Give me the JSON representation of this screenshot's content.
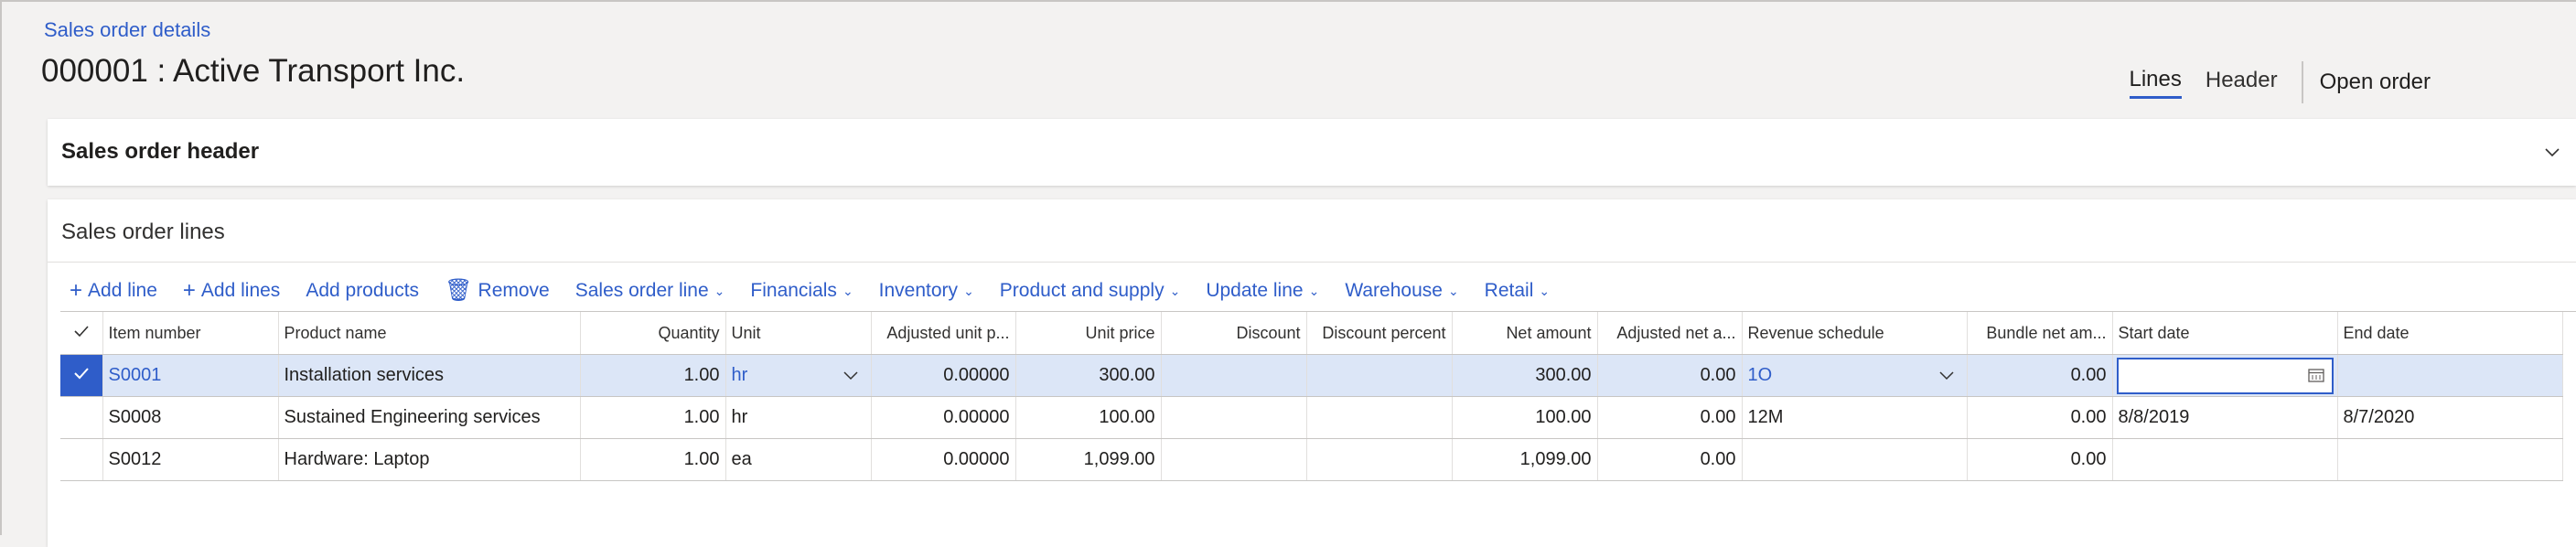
{
  "breadcrumb": "Sales order details",
  "page_title": "000001 : Active Transport Inc.",
  "tabs": {
    "lines": "Lines",
    "header": "Header",
    "open_order": "Open order"
  },
  "header_section": {
    "title": "Sales order header"
  },
  "lines_section": {
    "title": "Sales order lines"
  },
  "toolbar": {
    "add_line": "Add line",
    "add_lines": "Add lines",
    "add_products": "Add products",
    "remove": "Remove",
    "sales_order_line": "Sales order line",
    "financials": "Financials",
    "inventory": "Inventory",
    "product_and_supply": "Product and supply",
    "update_line": "Update line",
    "warehouse": "Warehouse",
    "retail": "Retail"
  },
  "grid": {
    "columns": [
      "Item number",
      "Product name",
      "Quantity",
      "Unit",
      "Adjusted unit p...",
      "Unit price",
      "Discount",
      "Discount percent",
      "Net amount",
      "Adjusted net a...",
      "Revenue schedule",
      "Bundle net am...",
      "Start date",
      "End date"
    ],
    "rows": [
      {
        "item": "S0001",
        "product": "Installation services",
        "qty": "1.00",
        "unit": "hr",
        "adj_unit_price": "0.00000",
        "unit_price": "300.00",
        "discount": "",
        "discount_percent": "",
        "net_amount": "300.00",
        "adj_net_amount": "0.00",
        "revenue_schedule": "1O",
        "bundle_net": "0.00",
        "start_date": "",
        "end_date": ""
      },
      {
        "item": "S0008",
        "product": "Sustained Engineering services",
        "qty": "1.00",
        "unit": "hr",
        "adj_unit_price": "0.00000",
        "unit_price": "100.00",
        "discount": "",
        "discount_percent": "",
        "net_amount": "100.00",
        "adj_net_amount": "0.00",
        "revenue_schedule": "12M",
        "bundle_net": "0.00",
        "start_date": "8/8/2019",
        "end_date": "8/7/2020"
      },
      {
        "item": "S0012",
        "product": "Hardware: Laptop",
        "qty": "1.00",
        "unit": "ea",
        "adj_unit_price": "0.00000",
        "unit_price": "1,099.00",
        "discount": "",
        "discount_percent": "",
        "net_amount": "1,099.00",
        "adj_net_amount": "0.00",
        "revenue_schedule": "",
        "bundle_net": "0.00",
        "start_date": "",
        "end_date": ""
      }
    ]
  },
  "colors": {
    "accent": "#2f5dc9",
    "selected_row": "#dce6f7"
  }
}
